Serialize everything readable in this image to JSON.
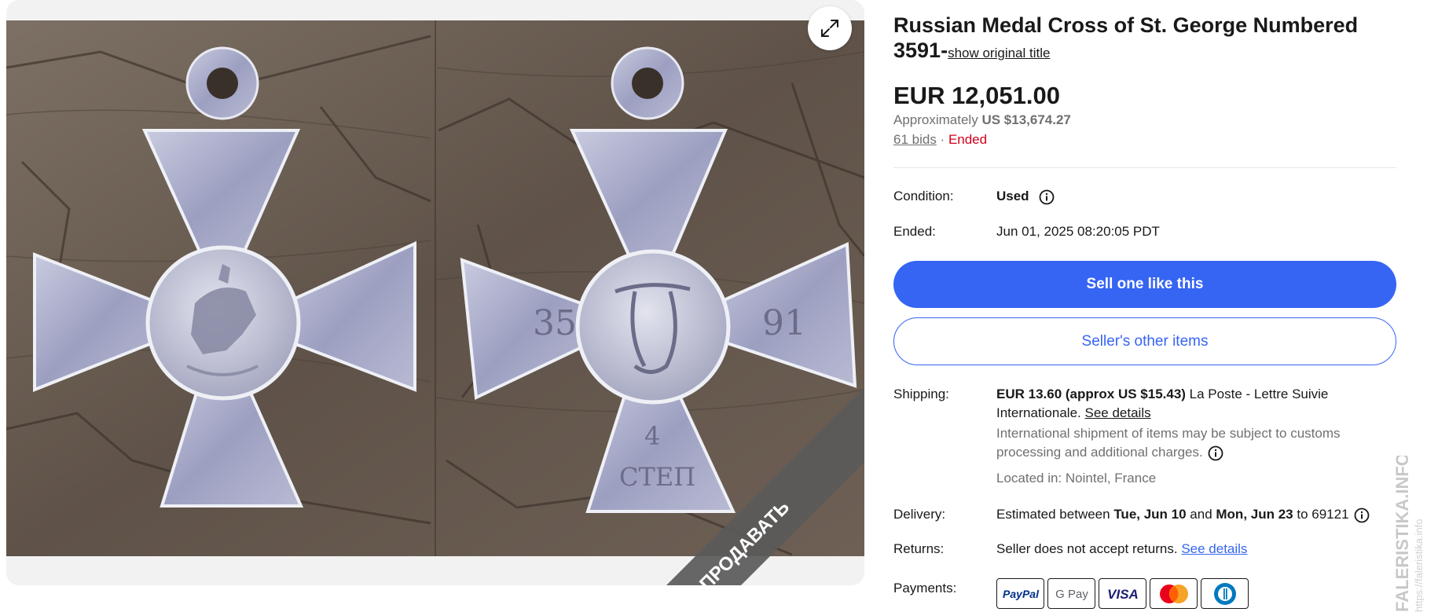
{
  "gallery": {
    "expand_icon": "expand-icon",
    "ribbon_text": "ПРОДАВАТЬ",
    "medal_left": {
      "icon": "st-george-cross-obverse"
    },
    "medal_right": {
      "icon": "st-george-cross-reverse",
      "number_left": "35",
      "number_right": "91",
      "class_text": "4",
      "class_abbrev": "СТЕП"
    }
  },
  "item": {
    "title": "Russian Medal Cross of St. George Numbered 3591-",
    "show_original_title": "show original title",
    "price": "EUR 12,051.00",
    "approx_label": "Approximately",
    "approx_value": "US $13,674.27",
    "bids_link": "61 bids",
    "separator": " · ",
    "status": "Ended"
  },
  "details": {
    "condition_label": "Condition:",
    "condition_value": "Used",
    "ended_label": "Ended:",
    "ended_value": "Jun 01, 2025 08:20:05 PDT"
  },
  "actions": {
    "sell_one_like_this": "Sell one like this",
    "sellers_other_items": "Seller's other items"
  },
  "shipping": {
    "label": "Shipping:",
    "cost": "EUR 13.60 (approx US $15.43)",
    "service": " La Poste - Lettre Suivie Internationale.",
    "see_details": "See details",
    "notice": "International shipment of items may be subject to customs processing and additional charges.",
    "location": "Located in: Nointel, France"
  },
  "delivery": {
    "label": "Delivery:",
    "prefix": "Estimated between ",
    "date_from": "Tue, Jun 10",
    "and": " and ",
    "date_to": "Mon, Jun 23",
    "to": " to 69121"
  },
  "returns": {
    "label": "Returns:",
    "text": "Seller does not accept returns.",
    "see_details": "See details"
  },
  "payments": {
    "label": "Payments:",
    "methods": [
      "PayPal",
      "G Pay",
      "VISA",
      "mastercard",
      "diners-club"
    ]
  },
  "watermark": {
    "line1": "FALERISTIKA.INFO",
    "line2": "https://faleristika.info"
  },
  "colors": {
    "primary": "#3665f3",
    "ended": "#d0021b",
    "muted": "#707070",
    "text": "#191919"
  }
}
